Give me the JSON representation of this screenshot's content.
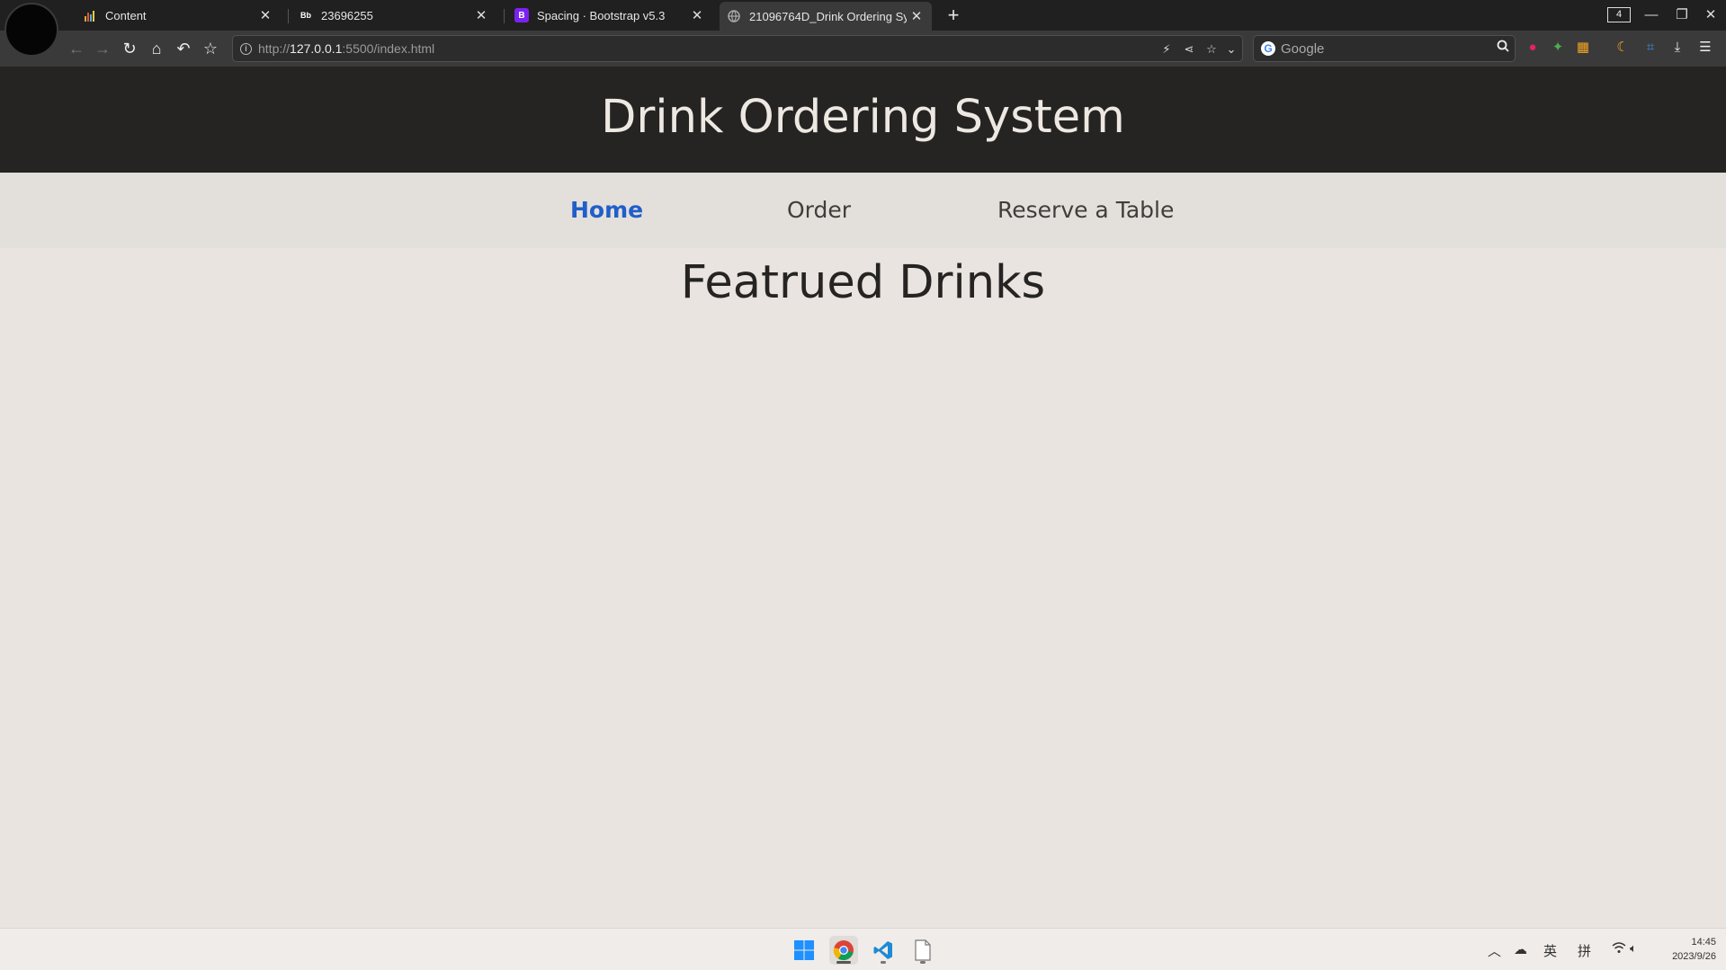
{
  "browser": {
    "tabs": [
      {
        "title": "Content",
        "close": "✕"
      },
      {
        "favicon": "Bb",
        "title": "23696255",
        "close": "✕"
      },
      {
        "favicon": "B",
        "title": "Spacing · Bootstrap v5.3",
        "close": "✕"
      },
      {
        "title": "21096764D_Drink Ordering Sy",
        "close": "✕"
      }
    ],
    "new_tab": "+",
    "tab_count": "4",
    "url_prefix": "http://",
    "url_host": "127.0.0.1",
    "url_rest": ":5500/index.html",
    "search_placeholder": "Google",
    "google_letter": "G"
  },
  "page": {
    "title": "Drink Ordering System",
    "nav": [
      {
        "label": "Home",
        "active": true
      },
      {
        "label": "Order"
      },
      {
        "label": "Reserve a Table"
      }
    ],
    "heading": "Featrued Drinks"
  },
  "taskbar": {
    "ime_lang": "英",
    "ime_mode": "拼",
    "time": "14:45",
    "date": "2023/9/26"
  },
  "colors": {
    "header_bg": "#252422",
    "page_bg": "#e9e4df",
    "nav_bg": "#e3dfdb",
    "active_link": "#1f5fc9"
  }
}
